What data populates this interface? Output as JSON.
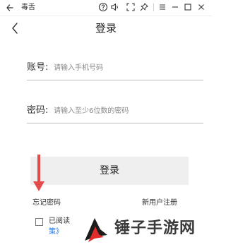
{
  "window": {
    "title": "毒舌",
    "controls": [
      "back-arrow-icon",
      "help-icon",
      "volume-icon",
      "fullscreen-icon",
      "pin-icon",
      "menu-icon",
      "minimize-icon",
      "maximize-icon",
      "close-icon"
    ]
  },
  "header": {
    "title": "登录"
  },
  "form": {
    "account_label": "账号:",
    "account_placeholder": "请输入手机号码",
    "password_label": "密码:",
    "password_placeholder": "请输入至少6位数的密码"
  },
  "login_button": "登录",
  "links": {
    "forgot": "忘记密码",
    "register": "新用户注册"
  },
  "agreement": {
    "checked": false,
    "text": "已阅读",
    "policy_fragment": "策》"
  },
  "watermark": {
    "text": "锤子手游网",
    "colors": {
      "logo_dark": "#1c1c1c",
      "logo_red": "#e02b2b"
    }
  },
  "colors": {
    "annotation_arrow": "#e54b4b",
    "button_bg": "#efefef",
    "link": "#1a73e8"
  }
}
